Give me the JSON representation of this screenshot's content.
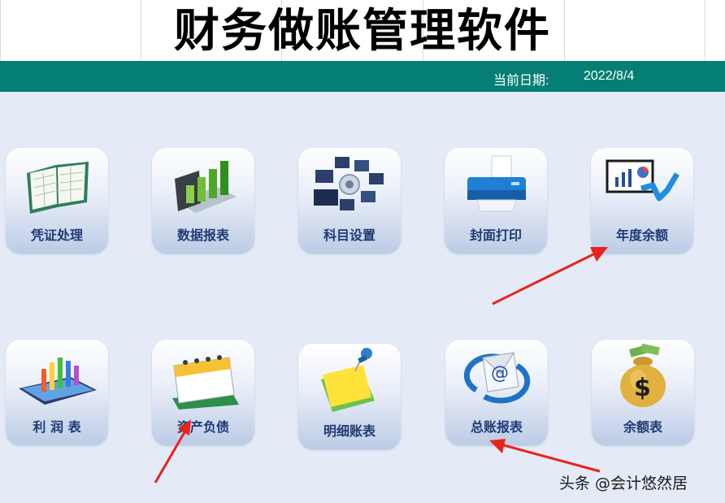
{
  "header": {
    "title": "财务做账管理软件",
    "date_label": "当前日期:",
    "date_value": "2022/8/4"
  },
  "colors": {
    "date_bar": "#057f73",
    "background": "#e4ebf7",
    "tile_label": "#1f3b73",
    "arrow": "#e8231d"
  },
  "tiles": [
    {
      "label": "凭证处理",
      "icon": "ledger-book-icon"
    },
    {
      "label": "数据报表",
      "icon": "bar-chart-3d-icon"
    },
    {
      "label": "科目设置",
      "icon": "settings-network-icon"
    },
    {
      "label": "封面打印",
      "icon": "printer-icon"
    },
    {
      "label": "年度余额",
      "icon": "trend-chart-icon"
    },
    {
      "label": "利 润 表",
      "icon": "column-chart-icon"
    },
    {
      "label": "资产负债",
      "icon": "calendar-icon"
    },
    {
      "label": "明细账表",
      "icon": "sticky-note-pin-icon"
    },
    {
      "label": "总账报表",
      "icon": "email-at-icon"
    },
    {
      "label": "余额表",
      "icon": "money-bag-icon"
    }
  ],
  "watermark": "头条 @会计悠然居"
}
